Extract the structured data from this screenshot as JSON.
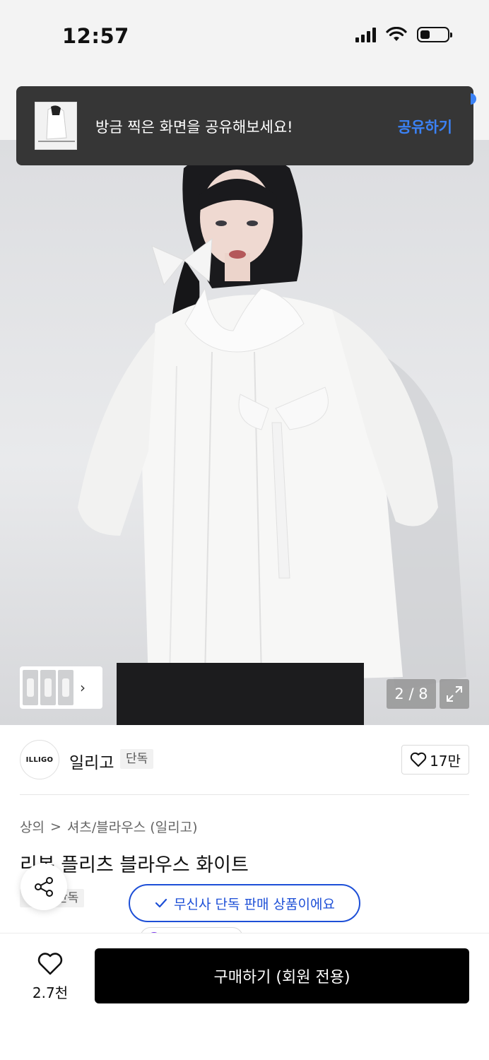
{
  "status_bar": {
    "time": "12:57",
    "battery_level": 0.35
  },
  "toast": {
    "message": "방금 찍은 화면을 공유해보세요!",
    "action_label": "공유하기",
    "accent_color": "#3b82f6"
  },
  "gallery": {
    "counter": "2 / 8",
    "thumbnail_strip_arrow": "›",
    "expand_icon": "expand-icon"
  },
  "brand": {
    "logo_text": "ILLIGO",
    "name": "일리고",
    "tag": "단독",
    "like_count": "17만"
  },
  "product": {
    "breadcrumb": [
      "상의",
      "셔츠/블라우스 (일리고)"
    ],
    "breadcrumb_separator": ">",
    "title": "리본 플리츠 블라우스 화이트",
    "exclusive_tag": "단독",
    "exclusive_notice": "무신사 단독 판매 상품이에요",
    "notice_color": "#1d4fd7"
  },
  "bottom_bar": {
    "wish_count": "2.7천",
    "buy_label": "구매하기 (회원 전용)"
  }
}
